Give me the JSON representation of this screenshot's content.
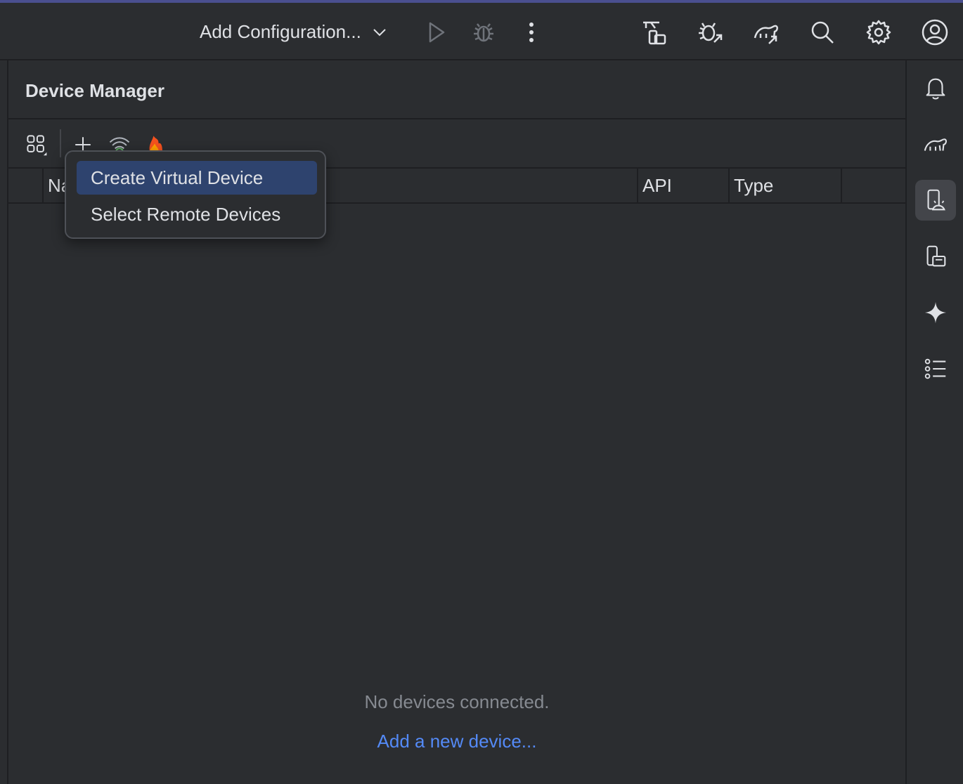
{
  "toolbar": {
    "config_label": "Add Configuration...",
    "icons": [
      "chevron-down-icon",
      "run-icon",
      "debug-icon",
      "more-vert-icon",
      "device-mirror-icon",
      "attach-debugger-icon",
      "gradle-sync-icon",
      "search-icon",
      "gear-icon",
      "account-icon"
    ]
  },
  "panel": {
    "title": "Device Manager",
    "toolbar_icons": [
      "group-icon",
      "add-icon",
      "wifi-pair-icon",
      "firebase-icon"
    ],
    "columns": [
      "Name",
      "API",
      "Type"
    ],
    "empty_text": "No devices connected.",
    "add_link": "Add a new device..."
  },
  "popup": {
    "items": [
      "Create Virtual Device",
      "Select Remote Devices"
    ],
    "selected_index": 0
  },
  "rightbar": {
    "icons": [
      "bell-icon",
      "gradle-icon",
      "device-manager-icon",
      "running-devices-icon",
      "gemini-icon",
      "structure-icon"
    ],
    "active_index": 2
  },
  "colors": {
    "background": "#2b2d30",
    "accent_selection": "#2e436e",
    "link": "#548af7",
    "muted_text": "#868a91",
    "firebase": "#f4511e"
  }
}
